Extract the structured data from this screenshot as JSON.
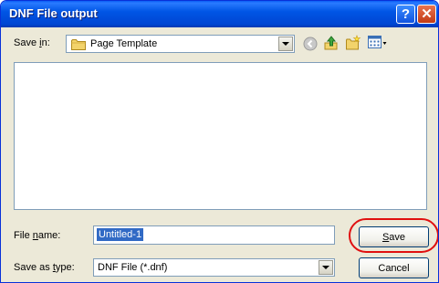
{
  "window": {
    "title": "DNF File output",
    "help_glyph": "?",
    "close_glyph": "✕"
  },
  "toolbar": {
    "save_in_label_pre": "Save ",
    "save_in_label_key": "i",
    "save_in_label_post": "n:",
    "save_in_value": "Page Template",
    "icons": [
      "back-icon",
      "up-folder-icon",
      "new-folder-icon",
      "views-menu-icon"
    ]
  },
  "form": {
    "file_name_label_pre": "File ",
    "file_name_label_key": "n",
    "file_name_label_post": "ame:",
    "file_name_value": "Untitled-1",
    "save_as_type_label_pre": "Save as ",
    "save_as_type_label_key": "t",
    "save_as_type_label_post": "ype:",
    "save_as_type_value": "DNF File (*.dnf)"
  },
  "buttons": {
    "save_key": "S",
    "save_rest": "ave",
    "cancel_label": "Cancel"
  },
  "colors": {
    "titlebar": "#0055e5",
    "dialog_bg": "#ece9d8",
    "selection": "#316ac5",
    "highlight": "#e01010"
  }
}
